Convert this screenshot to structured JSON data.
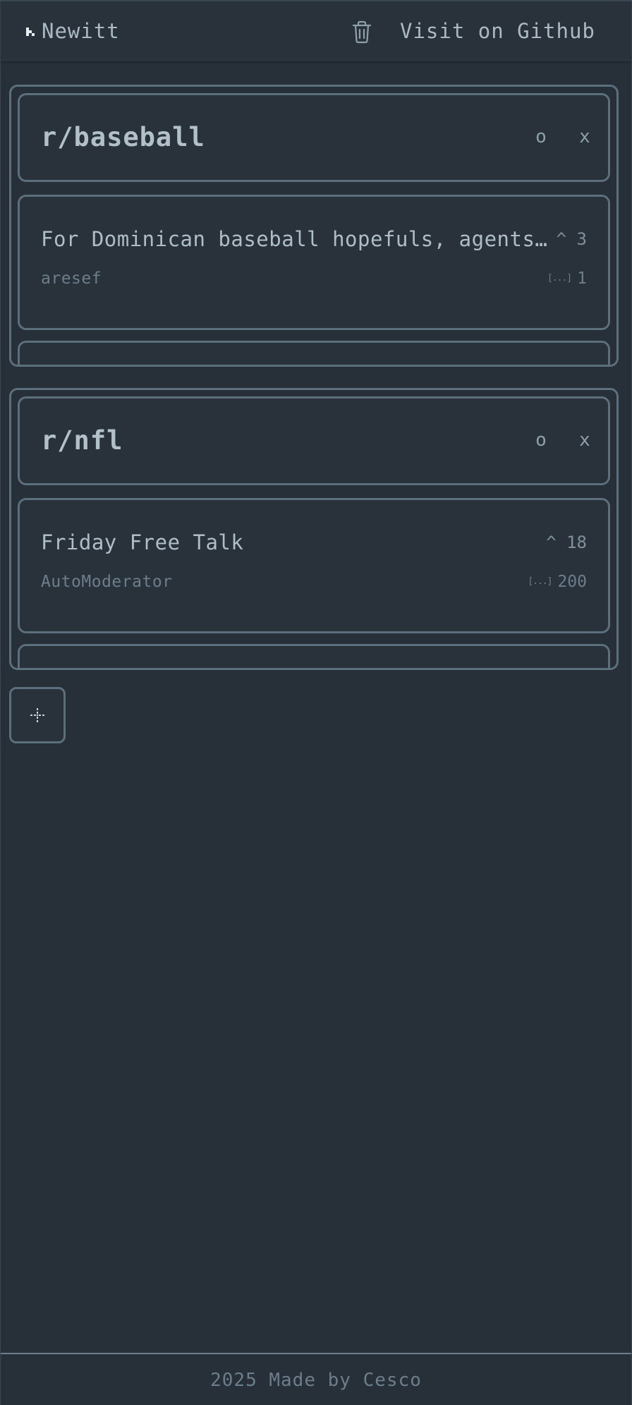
{
  "header": {
    "brand": "Newitt",
    "brand_icon": "cursor-arrow-icon",
    "clear_icon": "trash-icon",
    "github_link": "Visit on Github"
  },
  "columns": [
    {
      "title": "r/baseball",
      "refresh_label": "o",
      "close_label": "x",
      "posts": [
        {
          "title": "For Dominican baseball hopefuls, agents and buscones",
          "score": "^ 3",
          "author": "aresef",
          "comments": "1"
        }
      ]
    },
    {
      "title": "r/nfl",
      "refresh_label": "o",
      "close_label": "x",
      "posts": [
        {
          "title": "Friday Free Talk",
          "score": "^ 18",
          "author": "AutoModerator",
          "comments": "200"
        }
      ]
    }
  ],
  "add_column_icon": "plus-icon",
  "footer": {
    "text": "2025 Made by Cesco"
  },
  "colors": {
    "background": "#272f38",
    "surface": "#29323b",
    "border": "#5b6f7c",
    "text": "#aab9c4",
    "muted": "#6c7e8b"
  }
}
